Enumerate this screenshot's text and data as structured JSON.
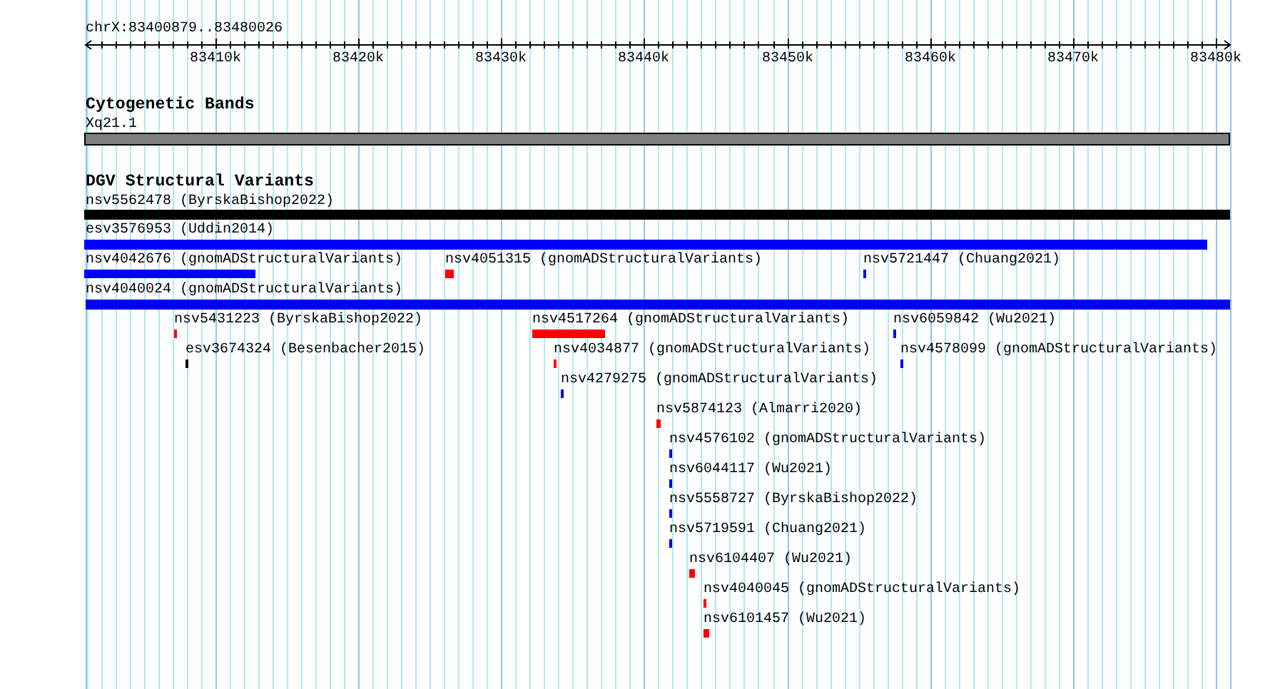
{
  "ruler": {
    "region": "chrX:83400879..83480026",
    "ticks": [
      "83410k",
      "83420k",
      "83430k",
      "83440k",
      "83450k",
      "83460k",
      "83470k",
      "83480k"
    ]
  },
  "cytogenetic_bands": {
    "title": "Cytogenetic Bands",
    "bands": [
      {
        "label": "Xq21.1"
      }
    ]
  },
  "structural_variants": {
    "title": "DGV Structural Variants",
    "features": [
      {
        "label": "nsv5562478 (ByrskaBishop2022)",
        "color": "#000000"
      },
      {
        "label": "esv3576953 (Uddin2014)",
        "color": "#0000ff"
      },
      {
        "label": "nsv4042676 (gnomADStructuralVariants)",
        "color": "#0000ff"
      },
      {
        "label": "nsv4051315 (gnomADStructuralVariants)",
        "color": "#ff0000"
      },
      {
        "label": "nsv5721447 (Chuang2021)",
        "color": "#0000ff"
      },
      {
        "label": "nsv4040024 (gnomADStructuralVariants)",
        "color": "#0000ff"
      },
      {
        "label": "nsv5431223 (ByrskaBishop2022)",
        "color": "#ff0000"
      },
      {
        "label": "nsv4517264 (gnomADStructuralVariants)",
        "color": "#ff0000"
      },
      {
        "label": "nsv6059842 (Wu2021)",
        "color": "#0000ff"
      },
      {
        "label": "esv3674324 (Besenbacher2015)",
        "color": "#000000"
      },
      {
        "label": "nsv4034877 (gnomADStructuralVariants)",
        "color": "#ff0000"
      },
      {
        "label": "nsv4578099 (gnomADStructuralVariants)",
        "color": "#0000ff"
      },
      {
        "label": "nsv4279275 (gnomADStructuralVariants)",
        "color": "#0000ff"
      },
      {
        "label": "nsv5874123 (Almarri2020)",
        "color": "#ff0000"
      },
      {
        "label": "nsv4576102 (gnomADStructuralVariants)",
        "color": "#0000ff"
      },
      {
        "label": "nsv6044117 (Wu2021)",
        "color": "#0000ff"
      },
      {
        "label": "nsv5558727 (ByrskaBishop2022)",
        "color": "#0000ff"
      },
      {
        "label": "nsv5719591 (Chuang2021)",
        "color": "#0000ff"
      },
      {
        "label": "nsv6104407 (Wu2021)",
        "color": "#ff0000"
      },
      {
        "label": "nsv4040045 (gnomADStructuralVariants)",
        "color": "#ff0000"
      },
      {
        "label": "nsv6101457 (Wu2021)",
        "color": "#ff0000"
      }
    ]
  }
}
